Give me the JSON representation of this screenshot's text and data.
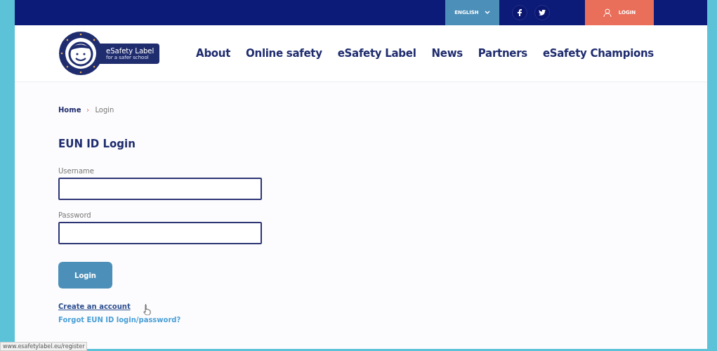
{
  "topbar": {
    "language": "ENGLISH",
    "login": "LOGIN"
  },
  "logo": {
    "title": "eSafety Label",
    "subtitle": "for a safer school"
  },
  "nav": [
    {
      "label": "About"
    },
    {
      "label": "Online safety"
    },
    {
      "label": "eSafety Label"
    },
    {
      "label": "News"
    },
    {
      "label": "Partners"
    },
    {
      "label": "eSafety Champions"
    }
  ],
  "breadcrumb": [
    {
      "label": "Home",
      "current": false
    },
    {
      "label": "Login",
      "current": true
    }
  ],
  "form": {
    "title": "EUN ID Login",
    "fields": [
      {
        "label": "Username"
      },
      {
        "label": "Password"
      }
    ],
    "submit": "Login",
    "links": [
      "Create an account",
      "Forgot EUN ID login/password?"
    ]
  },
  "status_bar": "www.esafetylabel.eu/register"
}
